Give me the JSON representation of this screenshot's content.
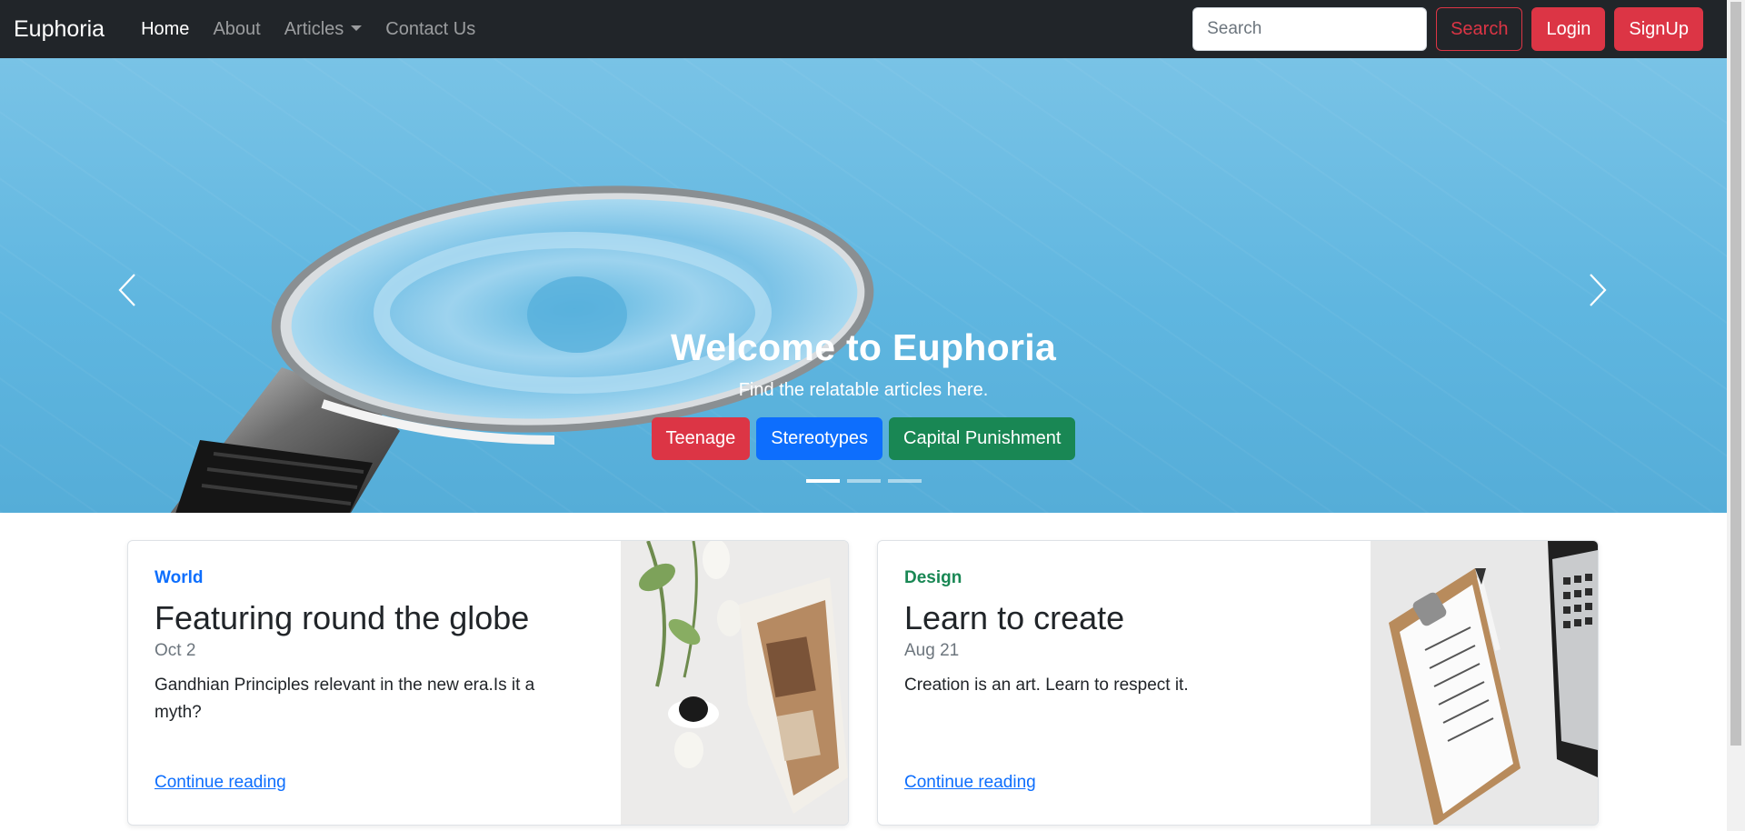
{
  "navbar": {
    "brand": "Euphoria",
    "links": [
      {
        "label": "Home"
      },
      {
        "label": "About"
      },
      {
        "label": "Articles"
      },
      {
        "label": "Contact Us"
      }
    ],
    "search_placeholder": "Search",
    "search_button": "Search",
    "login_button": "Login",
    "signup_button": "SignUp"
  },
  "carousel": {
    "title": "Welcome to Euphoria",
    "subtitle": "Find the relatable articles here.",
    "buttons": [
      {
        "label": "Teenage",
        "color": "#dc3545"
      },
      {
        "label": "Stereotypes",
        "color": "#0d6efd"
      },
      {
        "label": "Capital Punishment",
        "color": "#198754"
      }
    ],
    "active_slide": 1,
    "slide_count": 3,
    "prev_icon": "chevron-left-icon",
    "next_icon": "chevron-right-icon"
  },
  "cards": [
    {
      "category": "World",
      "title": "Featuring round the globe",
      "date": "Oct 2",
      "text": "Gandhian Principles relevant in the new era.Is it a myth?",
      "link": "Continue reading"
    },
    {
      "category": "Design",
      "title": "Learn to create",
      "date": "Aug 21",
      "text": "Creation is an art. Learn to respect it.",
      "link": "Continue reading"
    }
  ],
  "colors": {
    "navbar_bg": "#212529",
    "danger": "#dc3545",
    "primary": "#0d6efd",
    "success": "#198754",
    "hero_blue": "#5fb6e0"
  }
}
